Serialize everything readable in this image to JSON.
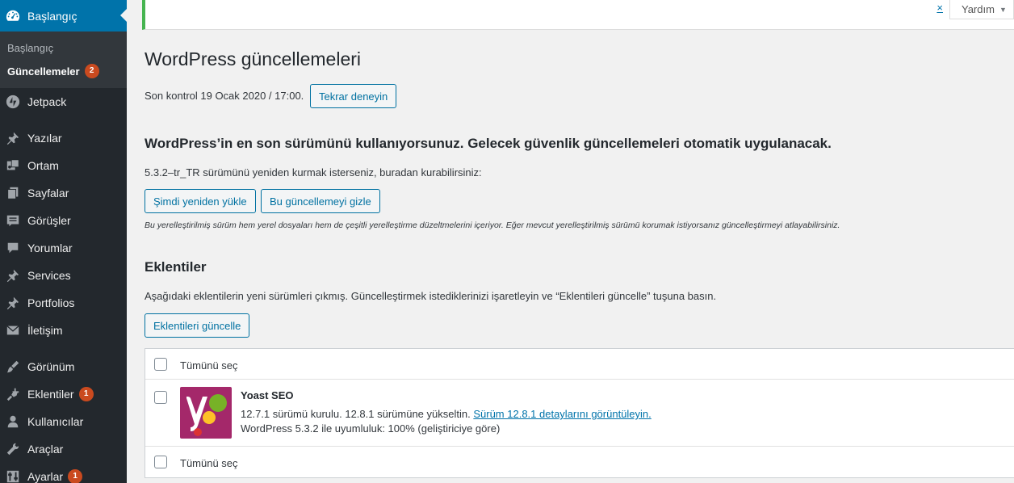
{
  "sidebar": {
    "top": {
      "label": "Başlangıç",
      "icon": "dashboard-icon"
    },
    "submenu": [
      {
        "label": "Başlangıç",
        "current": false
      },
      {
        "label": "Güncellemeler",
        "current": true,
        "badge": "2"
      }
    ],
    "items": [
      {
        "label": "Jetpack",
        "icon": "jetpack-icon"
      },
      {
        "label": "Yazılar",
        "icon": "pushpin-icon"
      },
      {
        "label": "Ortam",
        "icon": "media-icon"
      },
      {
        "label": "Sayfalar",
        "icon": "pages-icon"
      },
      {
        "label": "Görüşler",
        "icon": "feedback-icon"
      },
      {
        "label": "Yorumlar",
        "icon": "comments-icon"
      },
      {
        "label": "Services",
        "icon": "pushpin-icon"
      },
      {
        "label": "Portfolios",
        "icon": "pushpin-icon"
      },
      {
        "label": "İletişim",
        "icon": "mail-icon"
      },
      {
        "label": "Görünüm",
        "icon": "appearance-icon"
      },
      {
        "label": "Eklentiler",
        "icon": "plugins-icon",
        "badge": "1"
      },
      {
        "label": "Kullanıcılar",
        "icon": "users-icon"
      },
      {
        "label": "Araçlar",
        "icon": "tools-icon"
      },
      {
        "label": "Ayarlar",
        "icon": "settings-icon",
        "badge": "1"
      }
    ]
  },
  "topbar": {
    "dismiss": "×",
    "help_label": "Yardım"
  },
  "page": {
    "title": "WordPress güncellemeleri",
    "last_check": "Son kontrol 19 Ocak 2020 / 17:00.",
    "retry_button": "Tekrar deneyin",
    "latest_msg": "WordPress’in en son sürümünü kullanıyorsunuz. Gelecek güvenlik güncellemeleri otomatik uygulanacak.",
    "reinstall_hint": "5.3.2–tr_TR sürümünü yeniden kurmak isterseniz, buradan kurabilirsiniz:",
    "reinstall_button": "Şimdi yeniden yükle",
    "hide_button": "Bu güncellemeyi gizle",
    "localized_note": "Bu yerelleştirilmiş sürüm hem yerel dosyaları hem de çeşitli yerelleştirme düzeltmelerini içeriyor. Eğer mevcut yerelleştirilmiş sürümü korumak istiyorsanız güncelleştirmeyi atlayabilirsiniz."
  },
  "plugins": {
    "heading": "Eklentiler",
    "description": "Aşağıdaki eklentilerin yeni sürümleri çıkmış. Güncelleştirmek istediklerinizi işaretleyin ve “Eklentileri güncelle” tuşuna basın.",
    "update_button": "Eklentileri güncelle",
    "select_all": "Tümünü seç",
    "rows": [
      {
        "name": "Yoast SEO",
        "version_text": "12.7.1 sürümü kurulu. 12.8.1 sürümüne yükseltin.",
        "details_link": "Sürüm 12.8.1 detaylarını görüntüleyin.",
        "compat": "WordPress 5.3.2 ile uyumluluk: 100% (geliştiriciye göre)",
        "icon": "yoast-icon",
        "icon_color": "#a4286a"
      }
    ]
  }
}
